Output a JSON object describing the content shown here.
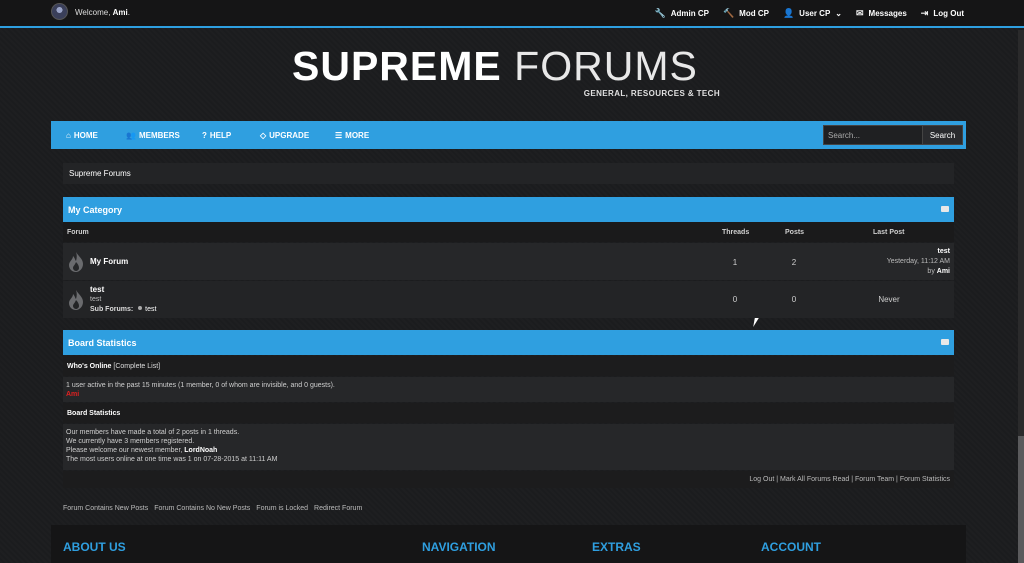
{
  "topbar": {
    "welcome_prefix": "Welcome, ",
    "username": "Ami",
    "links": [
      {
        "label": "Admin CP",
        "icon": "wrench-icon",
        "glyph": "🔧"
      },
      {
        "label": "Mod CP",
        "icon": "gavel-icon",
        "glyph": "🔨"
      },
      {
        "label": "User CP",
        "icon": "user-icon",
        "glyph": "👤"
      },
      {
        "label": "Messages",
        "icon": "inbox-icon",
        "glyph": "✉"
      },
      {
        "label": "Log Out",
        "icon": "sign-out-icon",
        "glyph": "⇥"
      }
    ]
  },
  "logo": {
    "bold": "SUPREME",
    "light": "FORUMS",
    "subtitle": "GENERAL, RESOURCES & TECH"
  },
  "nav": {
    "items": [
      "HOME",
      "MEMBERS",
      "HELP",
      "UPGRADE",
      "MORE"
    ],
    "search_placeholder": "Search...",
    "search_button": "Search"
  },
  "breadcrumb": "Supreme Forums",
  "category": {
    "title": "My Category",
    "headers": {
      "forum": "Forum",
      "threads": "Threads",
      "posts": "Posts",
      "last_post": "Last Post"
    },
    "forums": [
      {
        "title": "My Forum",
        "threads": "1",
        "posts": "2",
        "last_title": "test",
        "last_time": "Yesterday, 11:12 AM",
        "last_by": "by ",
        "last_user": "Ami"
      },
      {
        "title": "test",
        "desc": "test",
        "sub_label": "Sub Forums:",
        "sub_link": "test",
        "threads": "0",
        "posts": "0",
        "last": "Never"
      }
    ]
  },
  "stats": {
    "title": "Board Statistics",
    "online_label": "Who's Online",
    "online_link": "[Complete List]",
    "online_text": "1 user active in the past 15 minutes (1 member, 0 of whom are invisible, and 0 guests).",
    "online_user": "Ami",
    "stats_label": "Board Statistics",
    "line1": "Our members have made a total of 2 posts in 1 threads.",
    "line2": "We currently have 3 members registered.",
    "line3_prefix": "Please welcome our newest member, ",
    "newest_member": "LordNoah",
    "line4": "The most users online at one time was 1 on 07-28-2015 at 11:11 AM",
    "footer_links": "Log Out | Mark All Forums Read | Forum Team | Forum Statistics"
  },
  "legend": [
    "Forum Contains New Posts",
    "Forum Contains No New Posts",
    "Forum is Locked",
    "Redirect Forum"
  ],
  "footer": {
    "about": "ABOUT US",
    "navigation": "NAVIGATION",
    "extras": "EXTRAS",
    "account": "ACCOUNT"
  },
  "colors": {
    "accent": "#2f9fe0",
    "online_user": "#e02020"
  }
}
